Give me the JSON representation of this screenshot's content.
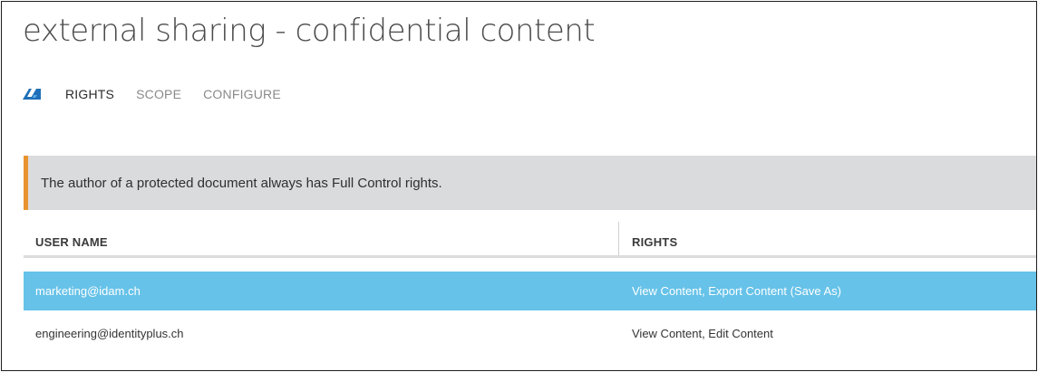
{
  "page": {
    "title": "external sharing - confidential content"
  },
  "nav": {
    "icon": "azure-rms-icon",
    "tabs": [
      {
        "label": "RIGHTS",
        "active": true
      },
      {
        "label": "SCOPE",
        "active": false
      },
      {
        "label": "CONFIGURE",
        "active": false
      }
    ]
  },
  "notice": {
    "text": "The author of a protected document always has Full Control rights.",
    "accent_color": "#e8932f"
  },
  "table": {
    "columns": [
      "USER NAME",
      "RIGHTS"
    ],
    "rows": [
      {
        "user": "marketing@idam.ch",
        "rights": "View Content, Export Content (Save As)",
        "selected": true
      },
      {
        "user": "engineering@identityplus.ch",
        "rights": "View Content, Edit Content",
        "selected": false
      }
    ],
    "selection_color": "#66c2e8"
  }
}
